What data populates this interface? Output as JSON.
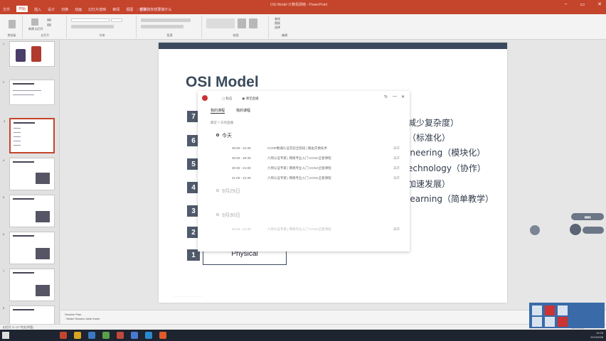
{
  "window": {
    "title": "OSI Model 计算机网络 - PowerPoint",
    "menu": [
      "文件",
      "开始",
      "插入",
      "设计",
      "切换",
      "动画",
      "幻灯片放映",
      "审阅",
      "视图",
      "帮助"
    ],
    "active_menu": "开始",
    "tell_me": "告诉我你想要做什么"
  },
  "ribbon": {
    "groups": [
      "剪贴板",
      "幻灯片",
      "字体",
      "段落",
      "绘图",
      "编辑"
    ],
    "edit_items": [
      "查找",
      "替换",
      "选择"
    ],
    "new_slide": "新建 幻灯片"
  },
  "thumbnails": [
    {
      "num": "1"
    },
    {
      "num": "2"
    },
    {
      "num": "3"
    },
    {
      "num": "4"
    },
    {
      "num": "5"
    },
    {
      "num": "6"
    },
    {
      "num": "7"
    },
    {
      "num": "8"
    }
  ],
  "slide": {
    "title": "OSI Model",
    "layers": [
      {
        "num": "7"
      },
      {
        "num": "6"
      },
      {
        "num": "5"
      },
      {
        "num": "4"
      },
      {
        "num": "3"
      },
      {
        "num": "2"
      },
      {
        "num": "1",
        "label": "Physical"
      }
    ],
    "side_lines": [
      "减少复杂度）",
      "（标准化）",
      "ineering（模块化）",
      "echnology（协作）",
      "加速发展）",
      "learning（简单教学）"
    ]
  },
  "popup": {
    "buttons": [
      "私信",
      "课堂直播"
    ],
    "controls": [
      "↻",
      "—",
      "✕"
    ],
    "tabs": [
      "我的课程",
      "我的课程"
    ],
    "hint": "最近 7 天的直播",
    "days": [
      {
        "label": "今天",
        "faded": false
      },
      {
        "label": "9月29日",
        "faded": true
      },
      {
        "label": "9月30日",
        "faded": true
      }
    ],
    "rows": [
      {
        "time": "20:00 - 21:30",
        "desc": "CCNP数通认证实验全程班 | 路由交换技术",
        "status": "· 未开",
        "faded": false
      },
      {
        "time": "20:00 - 20:30",
        "desc": "六周认证专家 | 网络专业入门 CCNA全套课程",
        "status": "· 未开",
        "faded": false
      },
      {
        "time": "20:30 - 21:00",
        "desc": "六周认证专家 | 网络专业入门 CCNA全套课程",
        "status": "· 未开",
        "faded": false
      },
      {
        "time": "21:00 - 21:30",
        "desc": "六周认证专家 | 网络专业入门 CCNA全套课程",
        "status": "· 未开",
        "faded": false
      },
      {
        "time": "20:00 - 21:30",
        "desc": "六周认证专家 | 网络专业入门 CCNA全套课程",
        "status": "· 未开",
        "faded": true
      }
    ]
  },
  "notes": {
    "lines": [
      "Session Plan",
      "· Model Session slide frame"
    ]
  },
  "status": {
    "left": "幻灯片 3 / 27   中文(中国)",
    "right": "备注   批注   145%"
  },
  "taskbar": {
    "clock": [
      "19:25",
      "2019/9/28"
    ]
  },
  "colors": {
    "accent": "#c4452c",
    "slide_dark": "#3b4a5e"
  }
}
